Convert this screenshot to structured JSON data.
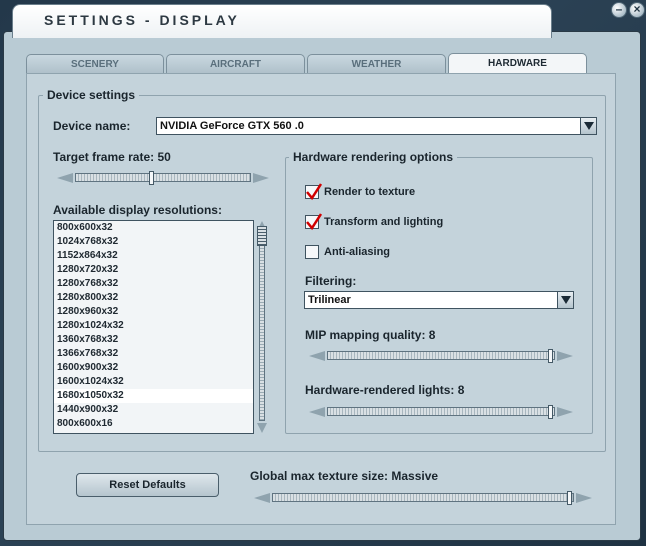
{
  "window": {
    "title": "SETTINGS - DISPLAY",
    "minimize_glyph": "–",
    "close_glyph": "×"
  },
  "tabs": [
    {
      "label": "SCENERY"
    },
    {
      "label": "AIRCRAFT"
    },
    {
      "label": "WEATHER"
    },
    {
      "label": "HARDWARE",
      "active": true
    }
  ],
  "device": {
    "group_label": "Device settings",
    "name_label": "Device name:",
    "name_value": "NVIDIA GeForce GTX 560 .0"
  },
  "frame_rate": {
    "label": "Target frame rate: 50",
    "value": 50
  },
  "resolutions": {
    "label": "Available display resolutions:",
    "items": [
      "800x600x32",
      "1024x768x32",
      "1152x864x32",
      "1280x720x32",
      "1280x768x32",
      "1280x800x32",
      "1280x960x32",
      "1280x1024x32",
      "1360x768x32",
      "1366x768x32",
      "1600x900x32",
      "1600x1024x32",
      "1680x1050x32",
      "1440x900x32",
      "800x600x16"
    ],
    "selected_index": 12
  },
  "hardware": {
    "group_label": "Hardware rendering options",
    "render_to_texture": {
      "label": "Render to texture",
      "checked": true
    },
    "transform_lighting": {
      "label": "Transform and lighting",
      "checked": true
    },
    "anti_aliasing": {
      "label": "Anti-aliasing",
      "checked": false
    },
    "filtering_label": "Filtering:",
    "filtering_value": "Trilinear",
    "mip_label": "MIP mapping quality: 8",
    "mip_value": 8,
    "lights_label": "Hardware-rendered lights: 8",
    "lights_value": 8
  },
  "global": {
    "texture_label": "Global max texture size: Massive",
    "reset_label": "Reset Defaults"
  },
  "colors": {
    "panel": "#c4d3db",
    "checkmark": "#d10000"
  }
}
